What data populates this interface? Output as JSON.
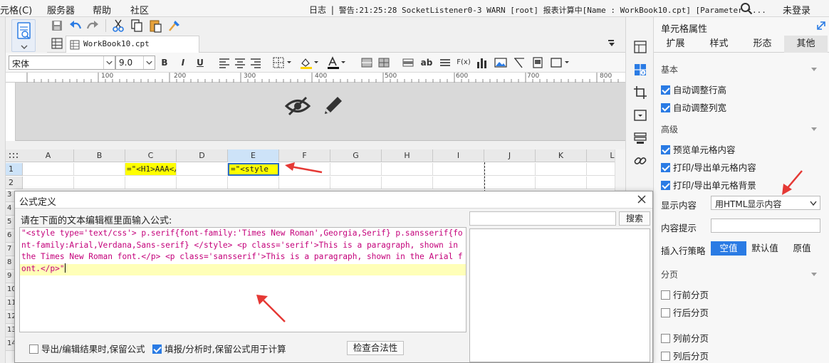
{
  "menubar": {
    "items": [
      "元格(C)",
      "服务器",
      "帮助",
      "社区"
    ],
    "log_label": "日志",
    "log_message": "警告:21:25:28 SocketListener0-3 WARN [root] 报表计算中[Name : WorkBook10.cpt] [Parameter :...",
    "user_label": "未登录"
  },
  "tab": {
    "label": "WorkBook10.cpt"
  },
  "format": {
    "font_family": "宋体",
    "font_size": "9.0",
    "bold": "B",
    "italic": "I",
    "underline": "U",
    "text_ab": "ab",
    "formula_fx": "F(x)"
  },
  "ruler": {
    "labels": [
      "100",
      "200",
      "300",
      "400",
      "500",
      "600",
      "700",
      "800"
    ]
  },
  "grid": {
    "columns": [
      "A",
      "B",
      "C",
      "D",
      "E",
      "F",
      "G",
      "H",
      "I",
      "J",
      "K",
      "L"
    ],
    "rows": [
      "1",
      "2"
    ],
    "cell_c1": "=\"<H1>AAA</",
    "cell_e1": "=\"<style",
    "left_rows": [
      "3",
      "4",
      "5",
      "6",
      "7",
      "8",
      "9",
      "10",
      "11",
      "12",
      "13",
      "14"
    ]
  },
  "panel": {
    "title": "单元格属性",
    "tabs": [
      "扩展",
      "样式",
      "形态",
      "其他"
    ],
    "active_tab": "其他",
    "sections": {
      "basic": "基本",
      "advanced": "高级",
      "paging": "分页"
    },
    "basic_checks": [
      "自动调整行高",
      "自动调整列宽"
    ],
    "advanced_checks": [
      "预览单元格内容",
      "打印/导出单元格内容",
      "打印/导出单元格背景"
    ],
    "display_label": "显示内容",
    "display_value": "用HTML显示内容",
    "tooltip_label": "内容提示",
    "tooltip_value": "",
    "insert_label": "插入行策略",
    "insert_options": [
      "空值",
      "默认值",
      "原值"
    ],
    "insert_active": "空值",
    "paging_checks": [
      "行前分页",
      "行后分页",
      "列前分页",
      "列后分页"
    ]
  },
  "dialog": {
    "title": "公式定义",
    "prompt": "请在下面的文本编辑框里面输入公式:",
    "formula": "\"<style type='text/css'> p.serif{font-family:'Times New Roman',Georgia,Serif} p.sansserif{font-family:Arial,Verdana,Sans-serif} </style> <p class='serif'>This is a paragraph, shown in the Times New Roman font.</p> <p class='sansserif'>This is a paragraph, shown in the Arial font.</p>\"",
    "search_placeholder": "",
    "search_button": "搜索",
    "keep_formula_export": "导出/编辑结果时,保留公式",
    "keep_formula_fill": "填报/分析时,保留公式用于计算",
    "validate_button": "检查合法性"
  },
  "colors": {
    "accent": "#2a7be4",
    "annotation_red": "#e53935",
    "formula_text": "#c4007a",
    "cell_highlight": "#ffff00",
    "header_band": "#d9d9d9"
  }
}
